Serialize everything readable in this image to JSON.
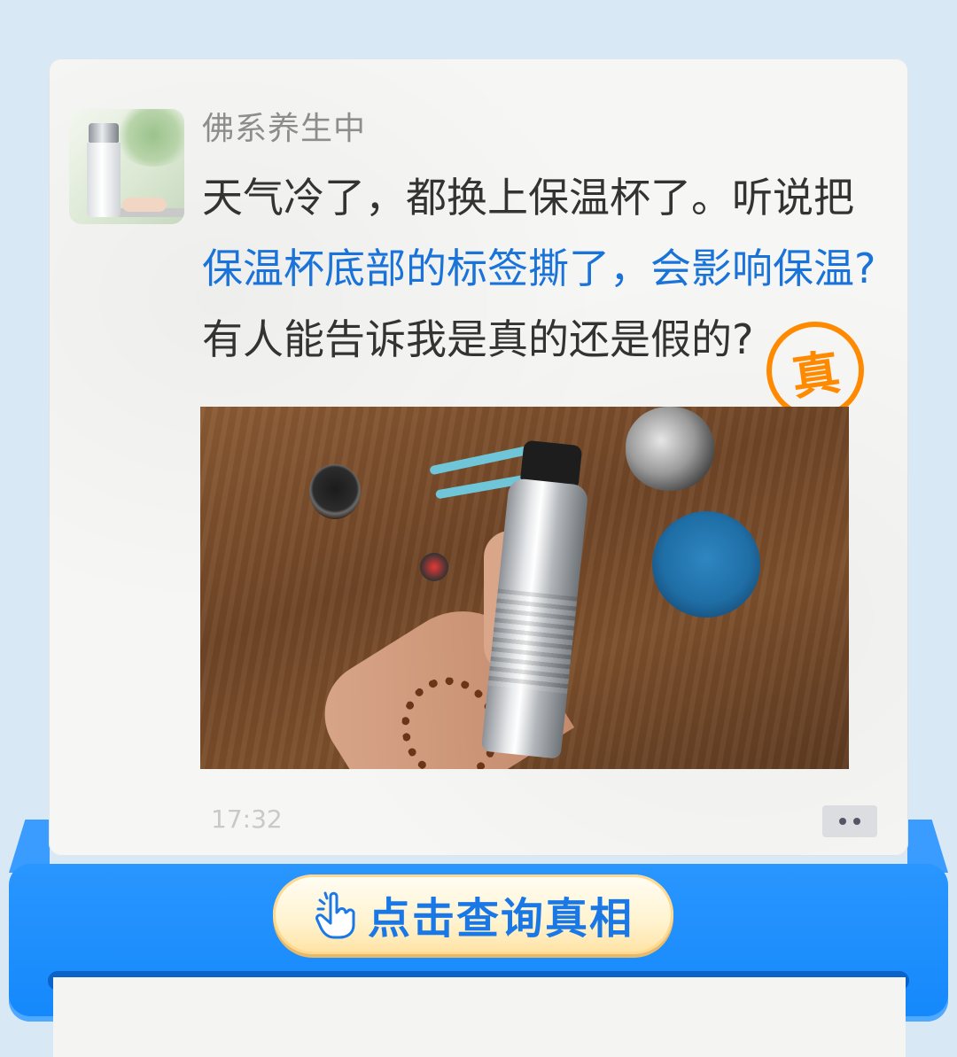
{
  "post": {
    "username": "佛系养生中",
    "message_line1": "天气冷了，都换上保温杯了。听说把",
    "message_line2": "保温杯底部的标签撕了，会影响保温?",
    "message_line3": "有人能告诉我是真的还是假的?",
    "stamp_text": "真",
    "time": "17:32"
  },
  "cta": {
    "label": "点击查询真相"
  },
  "colors": {
    "background": "#d8e9f5",
    "highlight_text": "#1a73d9",
    "stamp": "#ff8a00",
    "frame": "#1488fb"
  }
}
